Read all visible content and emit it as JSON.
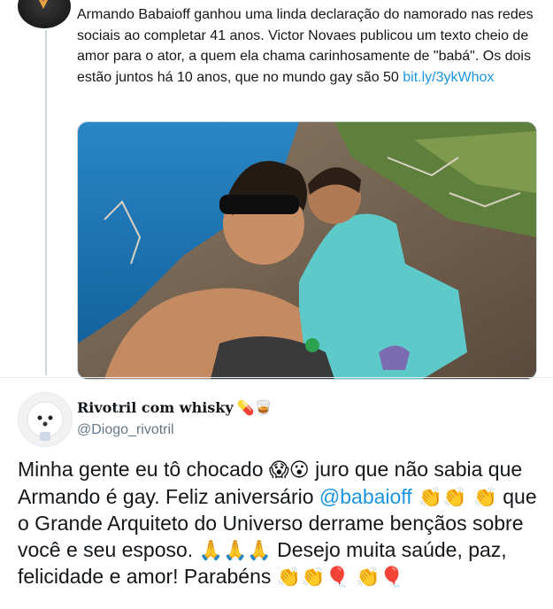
{
  "quoted_tweet": {
    "text": "Armando Babaioff ganhou uma linda declaração do namorado nas redes sociais ao completar 41 anos. Victor Novaes publicou um texto cheio de amor para o ator, a quem ela chama carinhosamente de \"babá\". Os dois estão juntos há 10 anos, que no mundo gay são 50 ",
    "link": "bit.ly/3ykWhox"
  },
  "tweet": {
    "display_name": "Rivotril com whisky",
    "name_emojis": "💊🥃",
    "handle": "@Diogo_rivotril",
    "text_1": "Minha gente eu tô chocado ",
    "emoji_1": "😱😮",
    "text_2": " juro que não sabia que Armando é gay. Feliz aniversário ",
    "mention": "@babaioff",
    "emoji_2": " 👏👏 👏",
    "text_3": " que o Grande Arquiteto do Universo derrame bençãos sobre você e seu esposo. ",
    "emoji_3": "🙏🙏🙏",
    "text_4": " Desejo muita saúde, paz, felicidade e amor! Parabéns ",
    "emoji_4": "👏👏🎈 👏🎈"
  }
}
